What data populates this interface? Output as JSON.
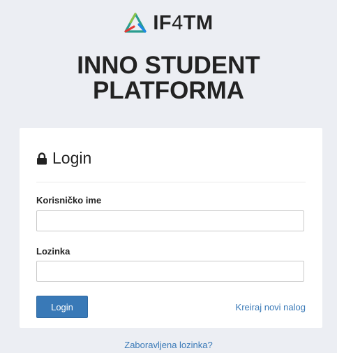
{
  "brand": {
    "logo_letters": "IF",
    "logo_digit": "4",
    "logo_tail": "TM",
    "title_line1": "INNO STUDENT",
    "title_line2": "PLATFORMA"
  },
  "login": {
    "heading": "Login",
    "username_label": "Korisničko ime",
    "username_value": "",
    "password_label": "Lozinka",
    "password_value": "",
    "submit_label": "Login",
    "register_link": "Kreiraj novi nalog"
  },
  "forgot_link": "Zaboravljena lozinka?",
  "colors": {
    "background": "#eceef3",
    "accent": "#3979b7"
  }
}
